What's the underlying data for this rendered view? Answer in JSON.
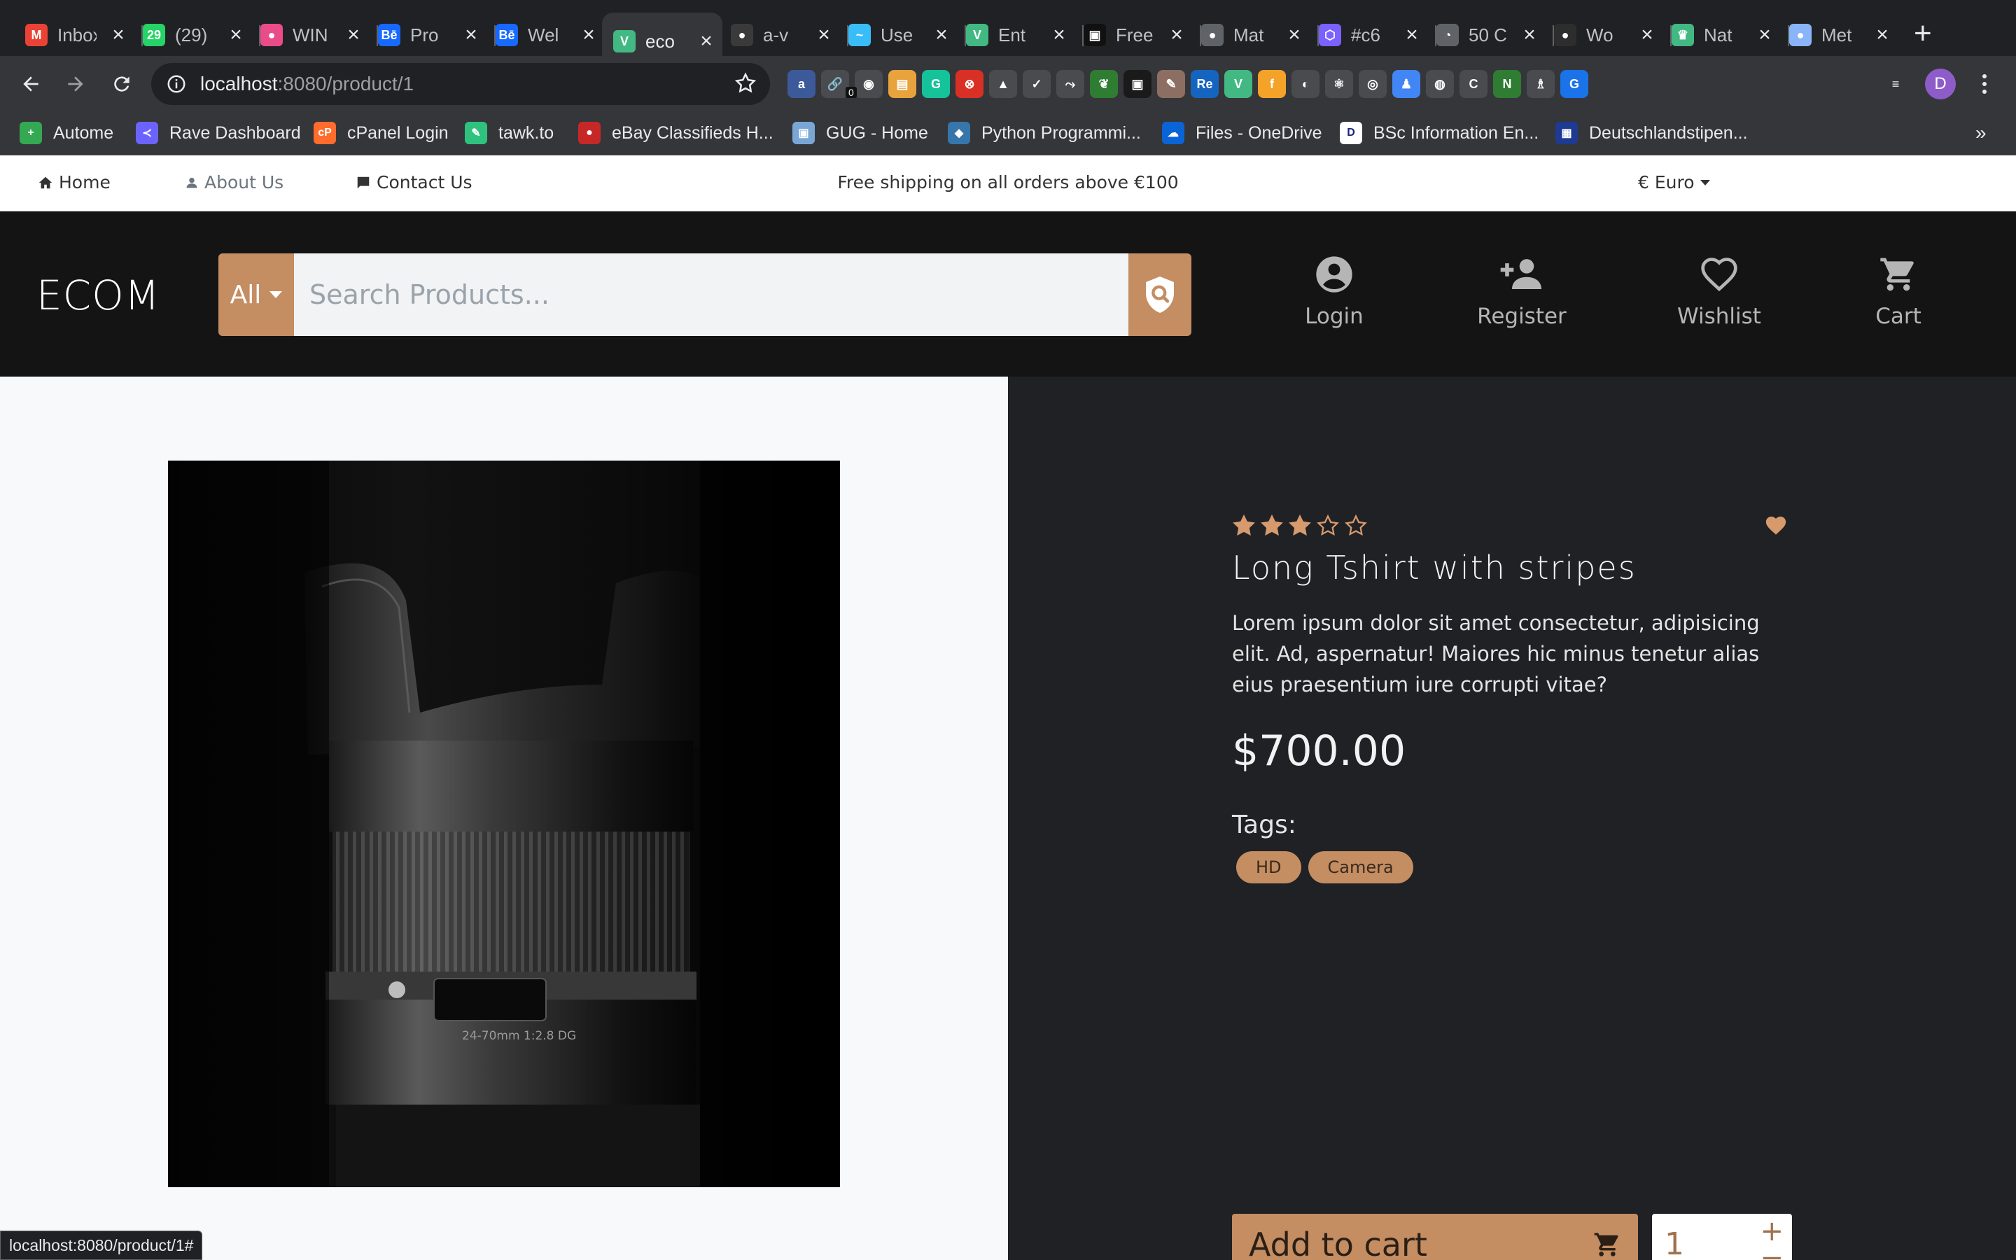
{
  "browser": {
    "tabs": [
      {
        "title": "Inbox",
        "icon": "gmail-icon",
        "color": "#ea4335",
        "glyph": "M"
      },
      {
        "title": "(29)",
        "icon": "whatsapp-icon",
        "color": "#25d366",
        "glyph": "29"
      },
      {
        "title": "WIN",
        "icon": "dribbble-icon",
        "color": "#ea4c89",
        "glyph": "●"
      },
      {
        "title": "Pro",
        "icon": "behance-icon",
        "color": "#1769ff",
        "glyph": "Bē"
      },
      {
        "title": "Wel",
        "icon": "behance-icon",
        "color": "#1769ff",
        "glyph": "Bē"
      },
      {
        "title": "eco",
        "icon": "vue-icon",
        "color": "#42b883",
        "glyph": "V",
        "active": true
      },
      {
        "title": "a-v",
        "icon": "github-icon",
        "color": "#3a3a3a",
        "glyph": "●"
      },
      {
        "title": "Use",
        "icon": "tailwind-icon",
        "color": "#38bdf8",
        "glyph": "~"
      },
      {
        "title": "Ent",
        "icon": "vue-icon",
        "color": "#42b883",
        "glyph": "V"
      },
      {
        "title": "Free",
        "icon": "unsplash-icon",
        "color": "#111111",
        "glyph": "▣"
      },
      {
        "title": "Mat",
        "icon": "globe-icon",
        "color": "#5f6368",
        "glyph": "●"
      },
      {
        "title": "#c6",
        "icon": "hex-icon",
        "color": "#7b61ff",
        "glyph": "⬡"
      },
      {
        "title": "50 C",
        "icon": "dashboard-icon",
        "color": "#5f6368",
        "glyph": "◔"
      },
      {
        "title": "Wo",
        "icon": "leaf-icon",
        "color": "#2d2d2d",
        "glyph": "●"
      },
      {
        "title": "Nat",
        "icon": "crown-icon",
        "color": "#42b883",
        "glyph": "♛"
      },
      {
        "title": "Met",
        "icon": "globe-icon",
        "color": "#8ab4f8",
        "glyph": "●"
      }
    ],
    "url": {
      "host": "localhost",
      "rest": ":8080/product/1"
    },
    "profile_initial": "D",
    "extension_badge": "0",
    "bookmarks": [
      {
        "label": "Autome",
        "icon": "plus-icon",
        "color": "#34a853",
        "glyph": "+"
      },
      {
        "label": "Rave Dashboard",
        "icon": "rave-icon",
        "color": "#6c63ff",
        "glyph": "≺"
      },
      {
        "label": "cPanel Login",
        "icon": "cpanel-icon",
        "color": "#ff6c2c",
        "glyph": "cP"
      },
      {
        "label": "tawk.to",
        "icon": "tawk-icon",
        "color": "#2ec27e",
        "glyph": "✎"
      },
      {
        "label": "eBay Classifieds H...",
        "icon": "ebay-icon",
        "color": "#c62828",
        "glyph": "●"
      },
      {
        "label": "GUG - Home",
        "icon": "gug-icon",
        "color": "#7aa6d6",
        "glyph": "▣"
      },
      {
        "label": "Python Programmi...",
        "icon": "python-icon",
        "color": "#3776ab",
        "glyph": "◆"
      },
      {
        "label": "Files - OneDrive",
        "icon": "onedrive-icon",
        "color": "#0a64d6",
        "glyph": "☁"
      },
      {
        "label": "BSc Information En...",
        "icon": "d-icon",
        "color": "#ffffff",
        "glyph": "D"
      },
      {
        "label": "Deutschlandstipen...",
        "icon": "grid-icon",
        "color": "#1f3a93",
        "glyph": "▦"
      }
    ],
    "status_url": "localhost:8080/product/1#"
  },
  "topbar": {
    "home": "Home",
    "about": "About Us",
    "contact": "Contact Us",
    "shipping": "Free shipping on all orders above €100",
    "currency": "€ Euro"
  },
  "header": {
    "logo": "ECOM",
    "category": "All",
    "search_placeholder": "Search Products...",
    "login": "Login",
    "register": "Register",
    "wishlist": "Wishlist",
    "cart": "Cart",
    "accent": "#c48d62"
  },
  "product": {
    "rating": 3,
    "rating_max": 5,
    "title": "Long Tshirt with stripes",
    "description": "Lorem ipsum dolor sit amet consectetur, adipisicing elit. Ad, aspernatur! Maiores hic minus tenetur alias eius praesentium iure corrupti vitae?",
    "price": "$700.00",
    "tags_label": "Tags:",
    "tags": [
      "HD",
      "Camera"
    ],
    "add_to_cart": "Add to cart",
    "quantity": "1",
    "image_lens_text": "24-70mm 1:2.8 DG"
  }
}
